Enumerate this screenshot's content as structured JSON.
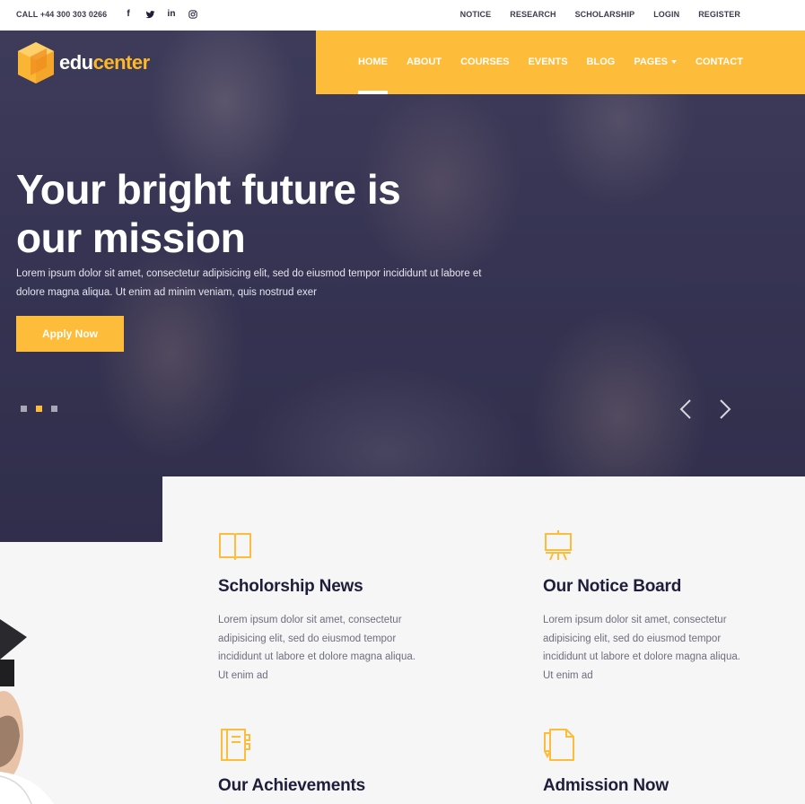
{
  "topbar": {
    "call_label": "CALL",
    "phone": "+44 300 303 0266",
    "social": [
      {
        "icon": "facebook-icon",
        "glyph": "f"
      },
      {
        "icon": "twitter-icon",
        "glyph": "t"
      },
      {
        "icon": "linkedin-icon",
        "glyph": "in"
      },
      {
        "icon": "instagram-icon",
        "glyph": "◎"
      }
    ],
    "links": [
      "NOTICE",
      "RESEARCH",
      "SCHOLARSHIP",
      "LOGIN",
      "REGISTER"
    ]
  },
  "brand": {
    "name_part1": "edu",
    "name_part2": "center",
    "accent": "#fdbc3a",
    "dark": "#1e1e3a"
  },
  "nav": {
    "items": [
      "HOME",
      "ABOUT",
      "COURSES",
      "EVENTS",
      "BLOG",
      "PAGES",
      "CONTACT"
    ],
    "active": "HOME"
  },
  "hero": {
    "title_line1": "Your bright future is",
    "title_line2": "our mission",
    "text": "Lorem ipsum dolor sit amet, consectetur adipisicing elit, sed do eiusmod tempor incididunt ut labore et dolore magna aliqua. Ut enim ad minim veniam, quis nostrud exer",
    "cta": "Apply Now",
    "slides": 3,
    "active_slide": 2
  },
  "features": [
    {
      "icon": "book-icon",
      "title": "Scholorship News",
      "text": "Lorem ipsum dolor sit amet, consectetur adipisicing elit, sed do eiusmod tempor incididunt ut labore et dolore magna aliqua. Ut enim ad"
    },
    {
      "icon": "easel-board-icon",
      "title": "Our Notice Board",
      "text": "Lorem ipsum dolor sit amet, consectetur adipisicing elit, sed do eiusmod tempor incididunt ut labore et dolore magna aliqua. Ut enim ad"
    },
    {
      "icon": "notebook-icon",
      "title": "Our Achievements",
      "text": ""
    },
    {
      "icon": "document-pen-icon",
      "title": "Admission Now",
      "text": ""
    }
  ]
}
